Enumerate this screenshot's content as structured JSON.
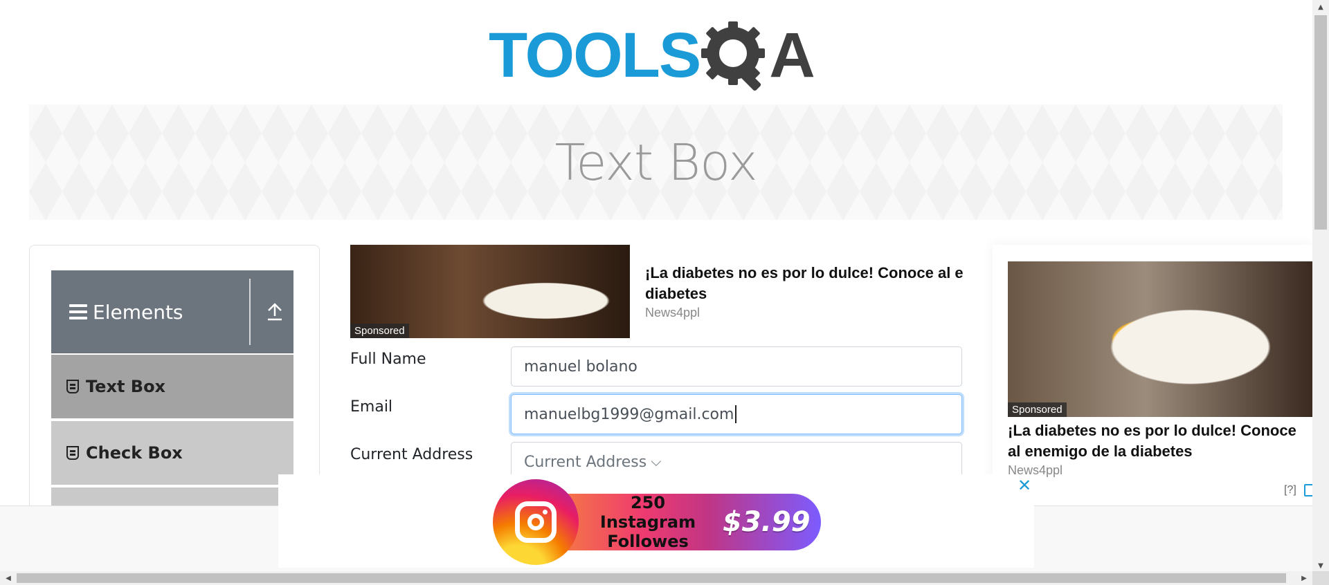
{
  "logo": {
    "tools": "TOOLS",
    "a": "A"
  },
  "banner": {
    "title": "Text Box"
  },
  "sidebar": {
    "group_label": "Elements",
    "items": [
      {
        "label": "Text Box",
        "active": true
      },
      {
        "label": "Check Box",
        "active": false
      }
    ]
  },
  "ad_top": {
    "sponsored": "Sponsored",
    "title_line1": "¡La diabetes no es por lo dulce! Conoce al e",
    "title_line2": "diabetes",
    "source": "News4ppl"
  },
  "form": {
    "full_name": {
      "label": "Full Name",
      "value": "manuel bolano"
    },
    "email": {
      "label": "Email",
      "value": "manuelbg1999@gmail.com"
    },
    "current_address": {
      "label": "Current Address",
      "placeholder": "Current Address"
    }
  },
  "ad_right": {
    "sponsored": "Sponsored",
    "title": "¡La diabetes no es por lo dulce! Conoce al enemigo de la diabetes",
    "source": "News4ppl",
    "help": "[?]"
  },
  "bottom_ad": {
    "line1": "250 Instagram",
    "line2": "Followes",
    "price": "$3.99",
    "close": "✕"
  },
  "colors": {
    "brand_blue": "#1a9ad6",
    "nav_header": "#6c757d",
    "nav_active": "#a3a3a3",
    "nav_item": "#c9c9c9"
  }
}
